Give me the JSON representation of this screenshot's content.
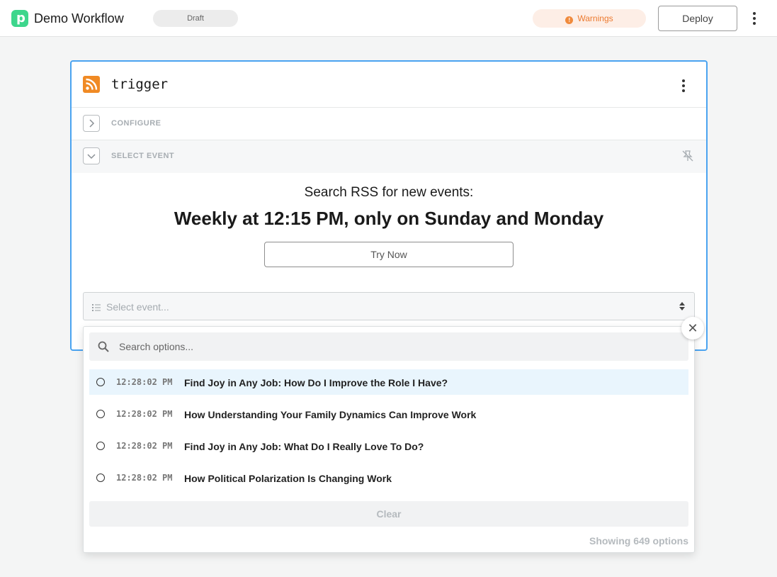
{
  "header": {
    "title": "Demo Workflow",
    "draft_label": "Draft",
    "warnings_label": "Warnings",
    "warnings_icon_glyph": "!",
    "deploy_label": "Deploy"
  },
  "step": {
    "name": "trigger",
    "configure_label": "CONFIGURE",
    "select_event_label": "SELECT EVENT",
    "search_title": "Search RSS for new events:",
    "schedule": "Weekly at 12:15 PM, only on Sunday and Monday",
    "try_now_label": "Try Now",
    "select_placeholder": "Select event..."
  },
  "dropdown": {
    "search_placeholder": "Search options...",
    "options": [
      {
        "time": "12:28:02 PM",
        "title": "Find Joy in Any Job: How Do I Improve the Role I Have?",
        "highlighted": true
      },
      {
        "time": "12:28:02 PM",
        "title": "How Understanding Your Family Dynamics Can Improve Work",
        "highlighted": false
      },
      {
        "time": "12:28:02 PM",
        "title": "Find Joy in Any Job: What Do I Really Love To Do?",
        "highlighted": false
      },
      {
        "time": "12:28:02 PM",
        "title": "How Political Polarization Is Changing Work",
        "highlighted": false
      }
    ],
    "clear_label": "Clear",
    "showing_label": "Showing 649 options",
    "close_glyph": "✕"
  },
  "colors": {
    "brand": "#3dd68c",
    "accent_border": "#4aa3f0",
    "warning": "#ec7a2f",
    "rss": "#f08a24"
  },
  "icons": {
    "logo": "pipedream-logo-icon",
    "rss": "rss-icon",
    "pin": "pin-off-icon",
    "search": "search-icon",
    "list": "list-icon",
    "select_arrows": "chevron-updown-icon"
  }
}
